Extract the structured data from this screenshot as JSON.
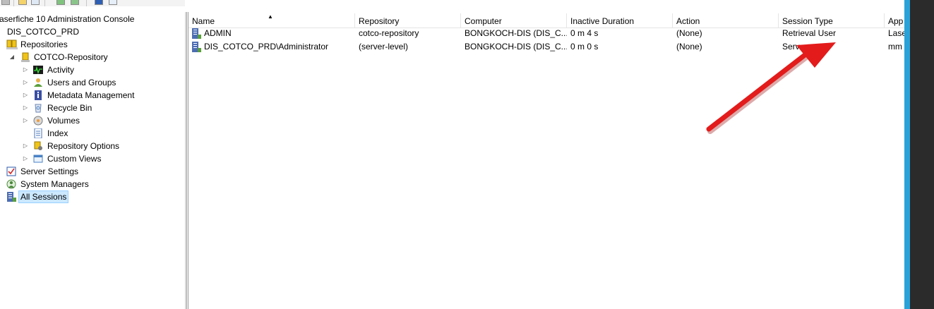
{
  "tree": {
    "items": [
      {
        "label": "aserfiche 10 Administration Console"
      },
      {
        "label": "DIS_COTCO_PRD"
      },
      {
        "label": "Repositories"
      },
      {
        "label": "COTCO-Repository"
      },
      {
        "label": "Activity"
      },
      {
        "label": "Users and Groups"
      },
      {
        "label": "Metadata Management"
      },
      {
        "label": "Recycle Bin"
      },
      {
        "label": "Volumes"
      },
      {
        "label": "Index"
      },
      {
        "label": "Repository Options"
      },
      {
        "label": "Custom Views"
      },
      {
        "label": "Server Settings"
      },
      {
        "label": "System Managers"
      },
      {
        "label": "All Sessions"
      }
    ]
  },
  "list": {
    "columns": [
      "Name",
      "Repository",
      "Computer",
      "Inactive Duration",
      "Action",
      "Session Type",
      "App"
    ],
    "rows": [
      {
        "cells": [
          "ADMIN",
          "cotco-repository",
          "BONGKOCH-DIS (DIS_C...",
          "0 m 4 s",
          "(None)",
          "Retrieval User",
          "Lase"
        ]
      },
      {
        "cells": [
          "DIS_COTCO_PRD\\Administrator",
          "(server-level)",
          "BONGKOCH-DIS (DIS_C...",
          "0 m 0 s",
          "(None)",
          "Server",
          "mm"
        ]
      }
    ]
  },
  "colors": {
    "selection": "#cce8ff",
    "annotation_arrow": "#e31b1b",
    "window_accent": "#29a2d9"
  }
}
